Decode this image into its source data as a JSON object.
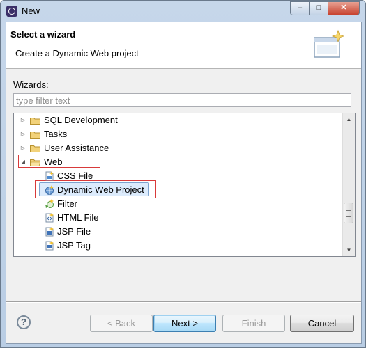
{
  "window": {
    "title": "New",
    "controls": {
      "minimize": "–",
      "maximize": "□",
      "close": "✕"
    }
  },
  "header": {
    "title": "Select a wizard",
    "description": "Create a Dynamic Web project"
  },
  "wizards": {
    "label": "Wizards:",
    "filter_placeholder": "type filter text",
    "filter_value": ""
  },
  "tree": {
    "items": [
      {
        "label": "SQL Development",
        "type": "folder",
        "expanded": false
      },
      {
        "label": "Tasks",
        "type": "folder",
        "expanded": false
      },
      {
        "label": "User Assistance",
        "type": "folder",
        "expanded": false
      },
      {
        "label": "Web",
        "type": "folder",
        "expanded": true
      },
      {
        "label": "CSS File",
        "type": "file"
      },
      {
        "label": "Dynamic Web Project",
        "type": "project",
        "selected": true
      },
      {
        "label": "Filter",
        "type": "filter"
      },
      {
        "label": "HTML File",
        "type": "file"
      },
      {
        "label": "JSP File",
        "type": "jsp"
      },
      {
        "label": "JSP Tag",
        "type": "jsp"
      }
    ]
  },
  "buttons": {
    "help": "?",
    "back": "< Back",
    "next": "Next >",
    "finish": "Finish",
    "cancel": "Cancel"
  },
  "colors": {
    "highlight_box": "#d83a3a",
    "selection_bg": "#dcebfc",
    "folder_fill": "#f2d27a"
  }
}
